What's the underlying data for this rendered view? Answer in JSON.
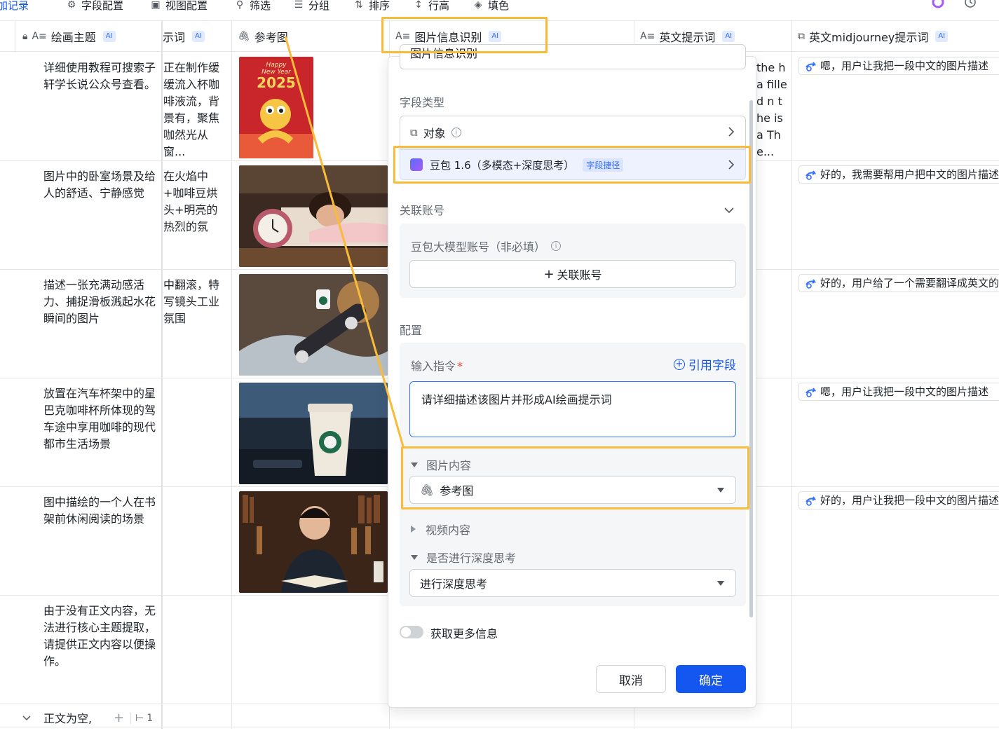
{
  "toolbar": {
    "add_record": "加记录",
    "field_config": "字段配置",
    "view_config": "视图配置",
    "filter": "筛选",
    "group": "分组",
    "sort": "排序",
    "row_height": "行高",
    "fill_color": "填色"
  },
  "columns": {
    "theme": {
      "title": "绘画主题",
      "tag": "AI"
    },
    "prompt": {
      "title": "示词",
      "tag": "AI"
    },
    "ref_image": {
      "title": "参考图"
    },
    "image_recog": {
      "title": "图片信息识别",
      "tag": "AI"
    },
    "en_prompt": {
      "title": "英文提示词",
      "tag": "AI"
    },
    "mj_prompt": {
      "title": "英文midjourney提示词",
      "tag": "AI"
    }
  },
  "rows": [
    {
      "theme": "详细使用教程可搜索子轩学长说公众号查看。",
      "prompt": "正在制作缓缓流入杯咖啡液流，背景有，聚焦咖然光从窗...",
      "en": "the h a filled n the is a The...",
      "mj": "嗯，用户让我把一段中文的图片描述",
      "thumb_text_1": "Happy",
      "thumb_text_2": "New Year",
      "thumb_text_3": "2025"
    },
    {
      "theme": "图片中的卧室场景及给人的舒适、宁静感觉",
      "prompt": "在火焰中+咖啡豆烘头+明亮的热烈的氛",
      "mj": "好的，我需要帮用户把中文的图片描述"
    },
    {
      "theme": "描述一张充满动感活力、捕捉滑板溅起水花瞬间的图片",
      "prompt": "中翻滚，特写镜头工业氛围",
      "mj": "好的，用户给了一个需要翻译成英文的"
    },
    {
      "theme": "放置在汽车杯架中的星巴克咖啡杯所体现的驾车途中享用咖啡的现代都市生活场景",
      "prompt": "",
      "mj": "嗯，用户让我把一段中文的图片描述"
    },
    {
      "theme": "图中描绘的一个人在书架前休闲阅读的场景",
      "prompt": "",
      "mj": "好的，用户让我把一段中文的图片描述"
    },
    {
      "theme": "由于没有正文内容，无法进行核心主题提取，请提供正文内容以便操作。",
      "prompt": "",
      "mj": ""
    }
  ],
  "group_row": {
    "label": "正文为空,",
    "count": "1"
  },
  "panel": {
    "top_input": "图片信息识别",
    "field_type_label": "字段类型",
    "field_type_value": "对象",
    "model_name": "豆包 1.6（多模态+深度思考）",
    "model_tag": "字段捷径",
    "linked_account_label": "关联账号",
    "account_label": "豆包大模型账号（非必填）",
    "link_account_btn": "关联账号",
    "config_label": "配置",
    "instruction_label": "输入指令",
    "required_mark": "*",
    "ref_field_link": "引用字段",
    "instruction_value": "请详细描述该图片并形成AI绘画提示词",
    "image_content_label": "图片内容",
    "image_content_value": "参考图",
    "video_content_label": "视频内容",
    "deep_think_label": "是否进行深度思考",
    "deep_think_value": "进行深度思考",
    "more_info_label": "获取更多信息",
    "cancel_btn": "取消",
    "confirm_btn": "确定"
  },
  "colors": {
    "accent": "#1456f0",
    "highlight": "#f8bb3a",
    "ai_tag_bg": "#e1eaff"
  }
}
